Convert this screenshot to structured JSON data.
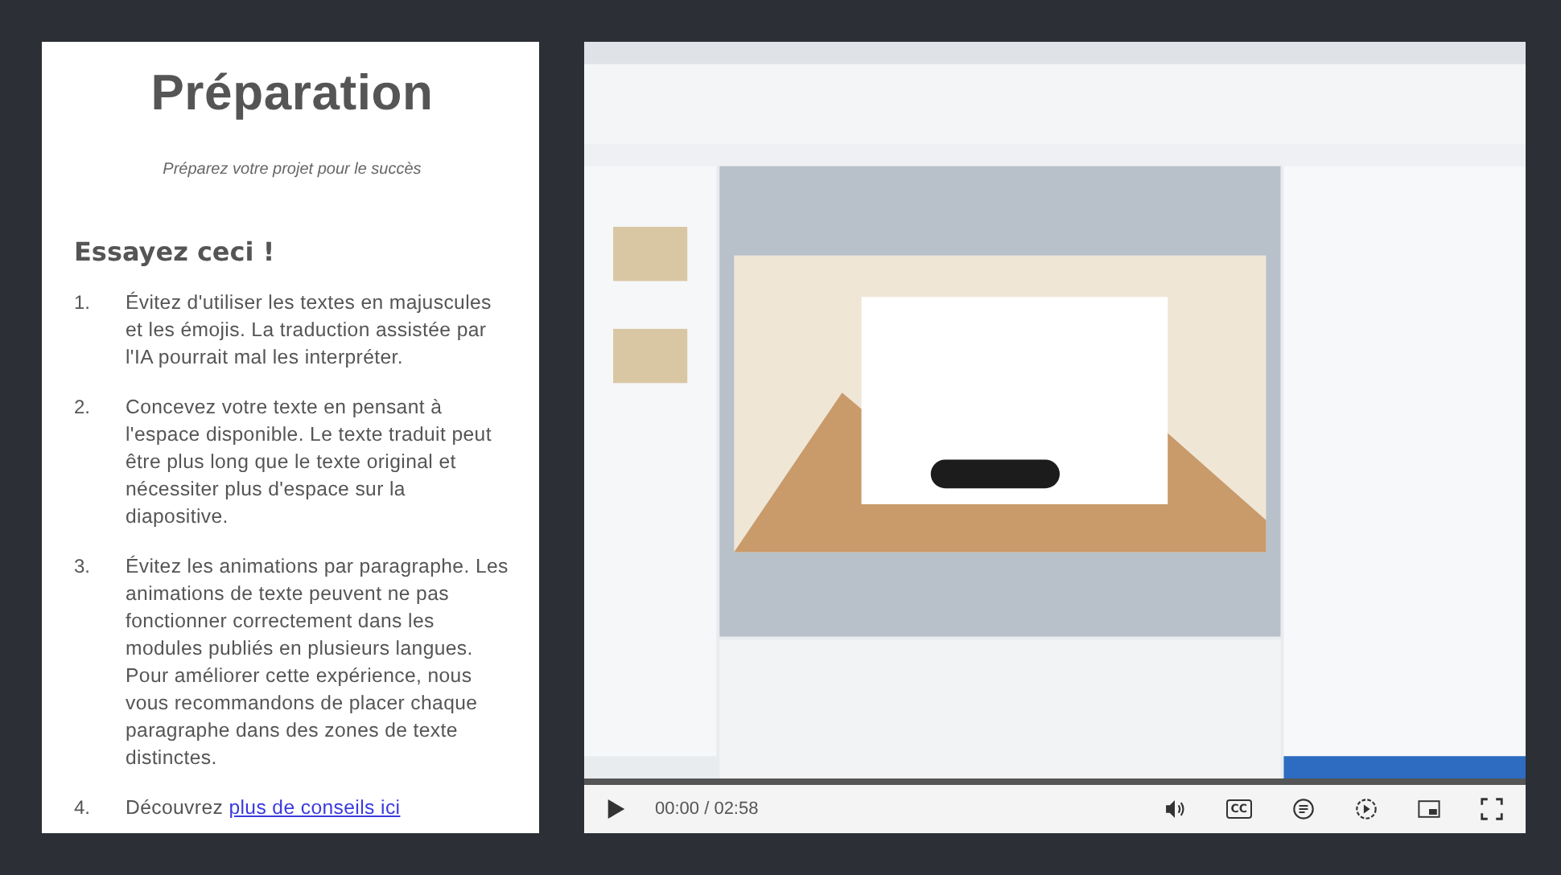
{
  "card": {
    "title": "Préparation",
    "subtitle": "Préparez votre projet pour le succès",
    "heading": "Essayez ceci !",
    "tips": [
      {
        "number": "1.",
        "text": "Évitez d'utiliser les textes en majuscules et les émojis. La traduction assistée par l'IA pourrait mal les interpréter."
      },
      {
        "number": "2.",
        "text": "Concevez votre texte en pensant à l'espace disponible. Le texte traduit peut être plus long que le texte original et nécessiter plus d'espace sur la diapositive."
      },
      {
        "number": "3.",
        "text": "Évitez les animations par paragraphe. Les animations de texte peuvent ne pas fonctionner correctement dans les modules publiés en plusieurs langues. Pour améliorer cette expérience, nous vous recommandons de placer chaque paragraphe dans des zones de texte distinctes."
      },
      {
        "number": "4.",
        "text": "Découvrez ",
        "link": "plus de conseils ici"
      }
    ]
  },
  "video": {
    "time": "00:00 / 02:58",
    "captions_label": "CC"
  }
}
